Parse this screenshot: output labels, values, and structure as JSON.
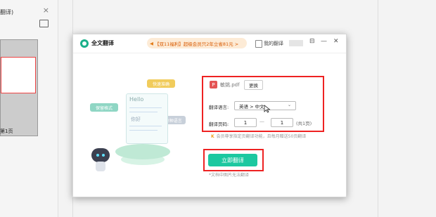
{
  "background": {
    "tab_label": "翻译)",
    "tab_close": "×",
    "thumbnail_label": "第1页"
  },
  "dialog": {
    "title": "全文翻译",
    "promo_text": "【双11福利】超级会员只2年立省81元 >",
    "my_translations": "我的翻译",
    "controls": {
      "pin": "⊟",
      "minimize": "—",
      "close": "✕"
    }
  },
  "illustration": {
    "bubble_fast": "快速准确",
    "bubble_format": "保留格式",
    "bubble_multi": "72种语言",
    "hello": "Hello",
    "nihao": "你好"
  },
  "form": {
    "file_icon": "P",
    "file_name": "敏姚.pdf",
    "change_label": "更换",
    "language_label": "翻译语言:",
    "language_value": "英语 > 中文",
    "pages_label": "翻译页码:",
    "page_from": "1",
    "page_to": "1",
    "page_total": "(共1页)",
    "page_dash": "—",
    "note_icon": "K",
    "note": "会员尊享指定页翻译功能，且每月赠送50页翻译",
    "translate_button": "立即翻译",
    "hint": "*文档中图片无法翻译"
  },
  "colors": {
    "accent": "#1cc8a0",
    "highlight_box": "#e22222",
    "promo_bg": "#fdebd6",
    "promo_text": "#d85a00"
  }
}
